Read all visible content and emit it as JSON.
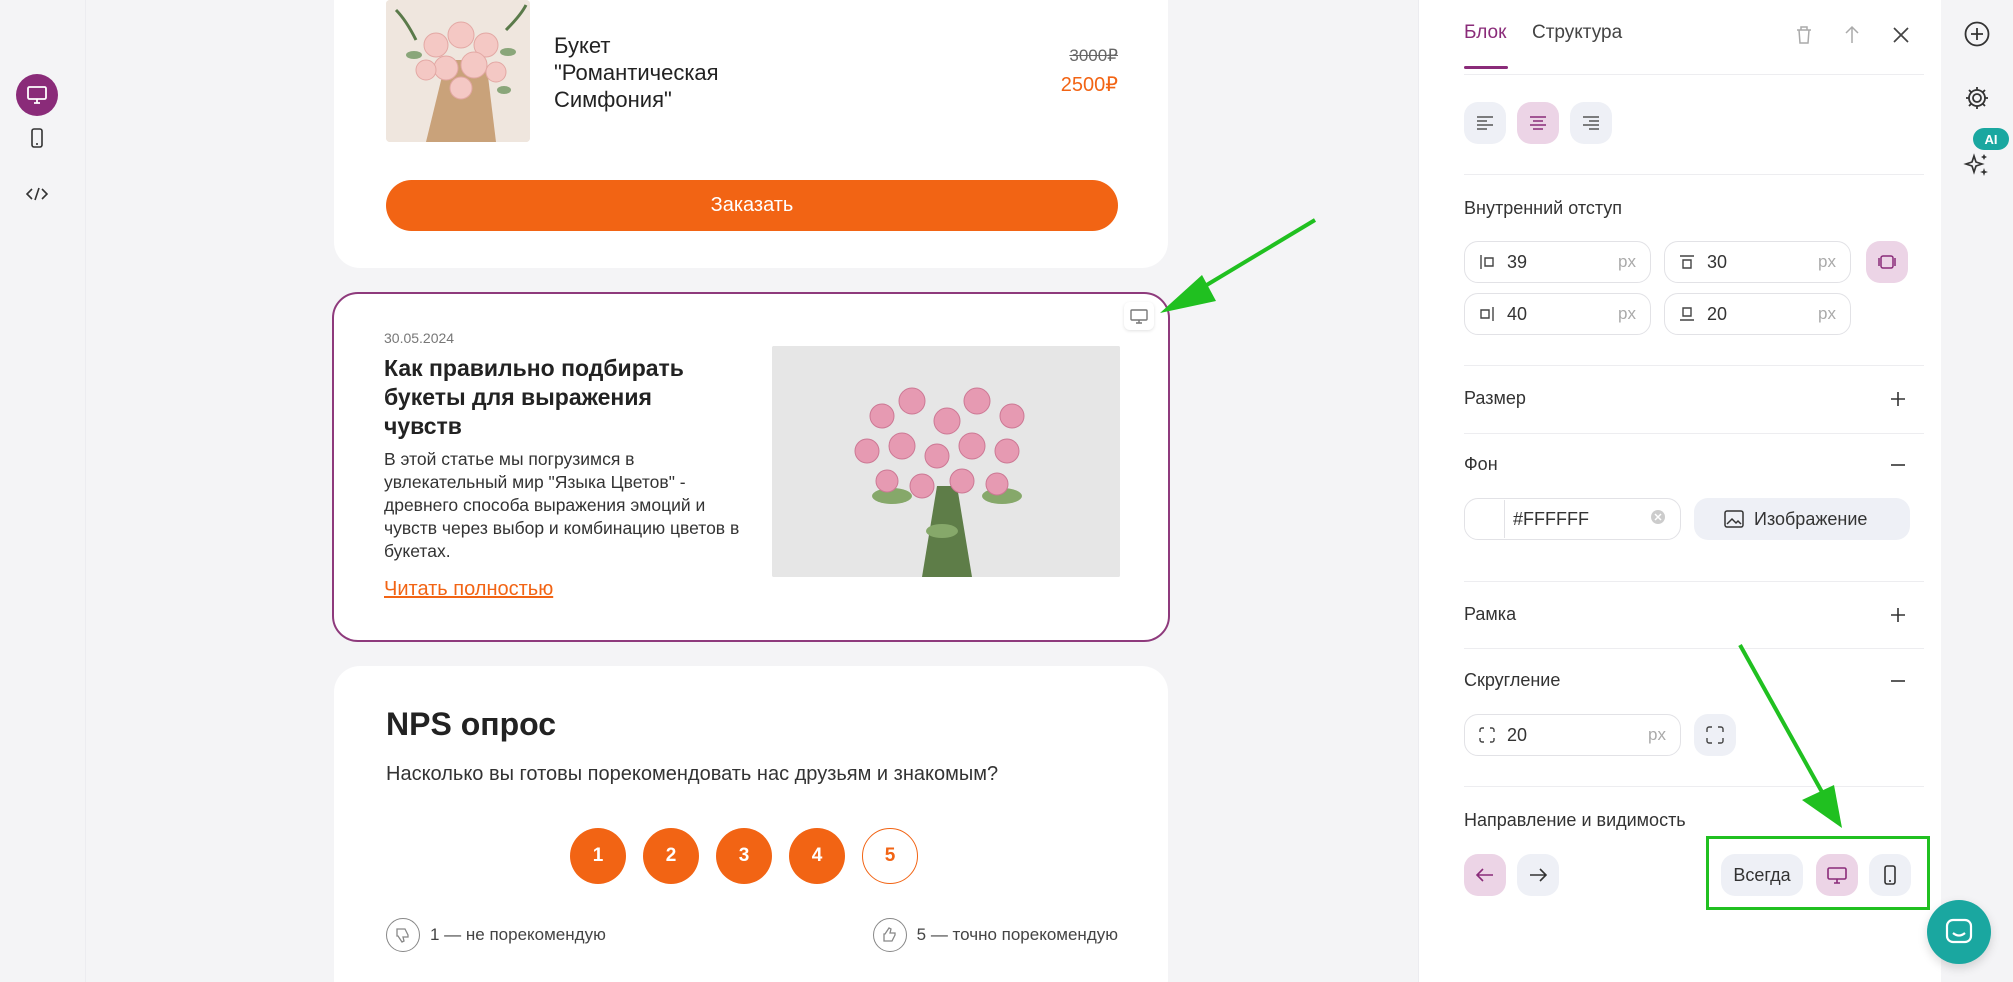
{
  "view_switcher": {
    "desktop_icon": "monitor-icon",
    "mobile_icon": "smartphone-icon",
    "code_icon": "code-icon"
  },
  "product": {
    "name": "Букет \"Романтическая Симфония\"",
    "price_old": "3000₽",
    "price_new": "2500₽",
    "order_label": "Заказать"
  },
  "article": {
    "date": "30.05.2024",
    "title": "Как правильно подбирать букеты для выражения чувств",
    "text": "В этой статье мы погрузимся в увлекательный мир \"Языка Цветов\" - древнего способа выражения эмоций и чувств через выбор и комбинацию цветов в букетах.",
    "link": "Читать полностью"
  },
  "nps": {
    "title": "NPS опрос",
    "question": "Насколько вы готовы порекомендовать нас друзьям и знакомым?",
    "scores": [
      "1",
      "2",
      "3",
      "4",
      "5"
    ],
    "low_label": "1 — не порекомендую",
    "high_label": "5 — точно порекомендую"
  },
  "panel": {
    "tabs": {
      "block": "Блок",
      "structure": "Структура"
    },
    "padding": {
      "title": "Внутренний отступ",
      "left": "39",
      "top": "30",
      "right": "40",
      "bottom": "20",
      "unit": "px"
    },
    "size": {
      "title": "Размер"
    },
    "background": {
      "title": "Фон",
      "color": "#FFFFFF",
      "image_label": "Изображение"
    },
    "border": {
      "title": "Рамка"
    },
    "radius": {
      "title": "Скругление",
      "value": "20",
      "unit": "px"
    },
    "visibility": {
      "title": "Направление и видимость",
      "always_label": "Всегда"
    }
  },
  "ai_badge": "AI",
  "colors": {
    "accent": "#8a2b79",
    "orange": "#f26414",
    "teal": "#1aa7a0",
    "annotation_green": "#20c020"
  }
}
